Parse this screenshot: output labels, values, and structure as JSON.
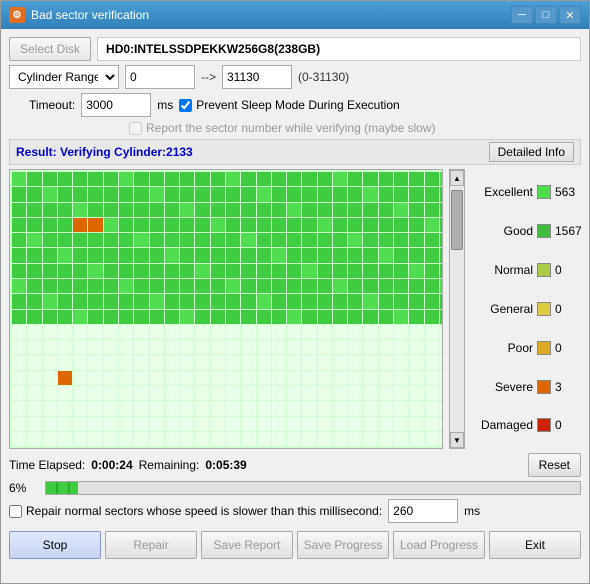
{
  "window": {
    "title": "Bad sector verification",
    "icon": "HDD"
  },
  "controls": {
    "select_disk_label": "Select Disk",
    "disk_value": "HD0:INTELSSDPEKKW256G8(238GB)",
    "cylinder_range_label": "Cylinder Range",
    "range_start": "0",
    "range_end": "31130",
    "range_info": "(0-31130)",
    "arrow": "-->",
    "timeout_label": "Timeout:",
    "timeout_value": "3000",
    "timeout_unit": "ms",
    "prevent_sleep_label": "Prevent Sleep Mode During Execution",
    "prevent_sleep_checked": true,
    "report_sector_label": "Report the sector number while verifying (maybe slow)",
    "report_sector_checked": false
  },
  "result": {
    "text": "Result: Verifying Cylinder:2133",
    "detail_btn": "Detailed Info"
  },
  "legend": {
    "items": [
      {
        "label": "Excellent",
        "color": "#50dd50",
        "count": "563"
      },
      {
        "label": "Good",
        "color": "#40bb40",
        "count": "1567"
      },
      {
        "label": "Normal",
        "color": "#aacc44",
        "count": "0"
      },
      {
        "label": "General",
        "color": "#ddcc44",
        "count": "0"
      },
      {
        "label": "Poor",
        "color": "#ddaa22",
        "count": "0"
      },
      {
        "label": "Severe",
        "color": "#dd6600",
        "count": "3"
      },
      {
        "label": "Damaged",
        "color": "#cc2200",
        "count": "0"
      }
    ]
  },
  "progress": {
    "elapsed_label": "Time Elapsed:",
    "elapsed": "0:00:24",
    "remaining_label": "Remaining:",
    "remaining": "0:05:39",
    "reset_btn": "Reset",
    "percent": "6%"
  },
  "repair": {
    "checkbox_label": "Repair normal sectors whose speed is slower than this millisecond:",
    "ms_value": "260",
    "ms_unit": "ms"
  },
  "buttons": {
    "stop": "Stop",
    "repair": "Repair",
    "save_report": "Save Report",
    "save_progress": "Save Progress",
    "load_progress": "Load Progress",
    "exit": "Exit"
  },
  "colors": {
    "accent": "#3080b8",
    "green_good": "#40cc40",
    "green_excellent": "#60dd60",
    "orange_severe": "#dd6600",
    "red_damaged": "#cc2200"
  }
}
